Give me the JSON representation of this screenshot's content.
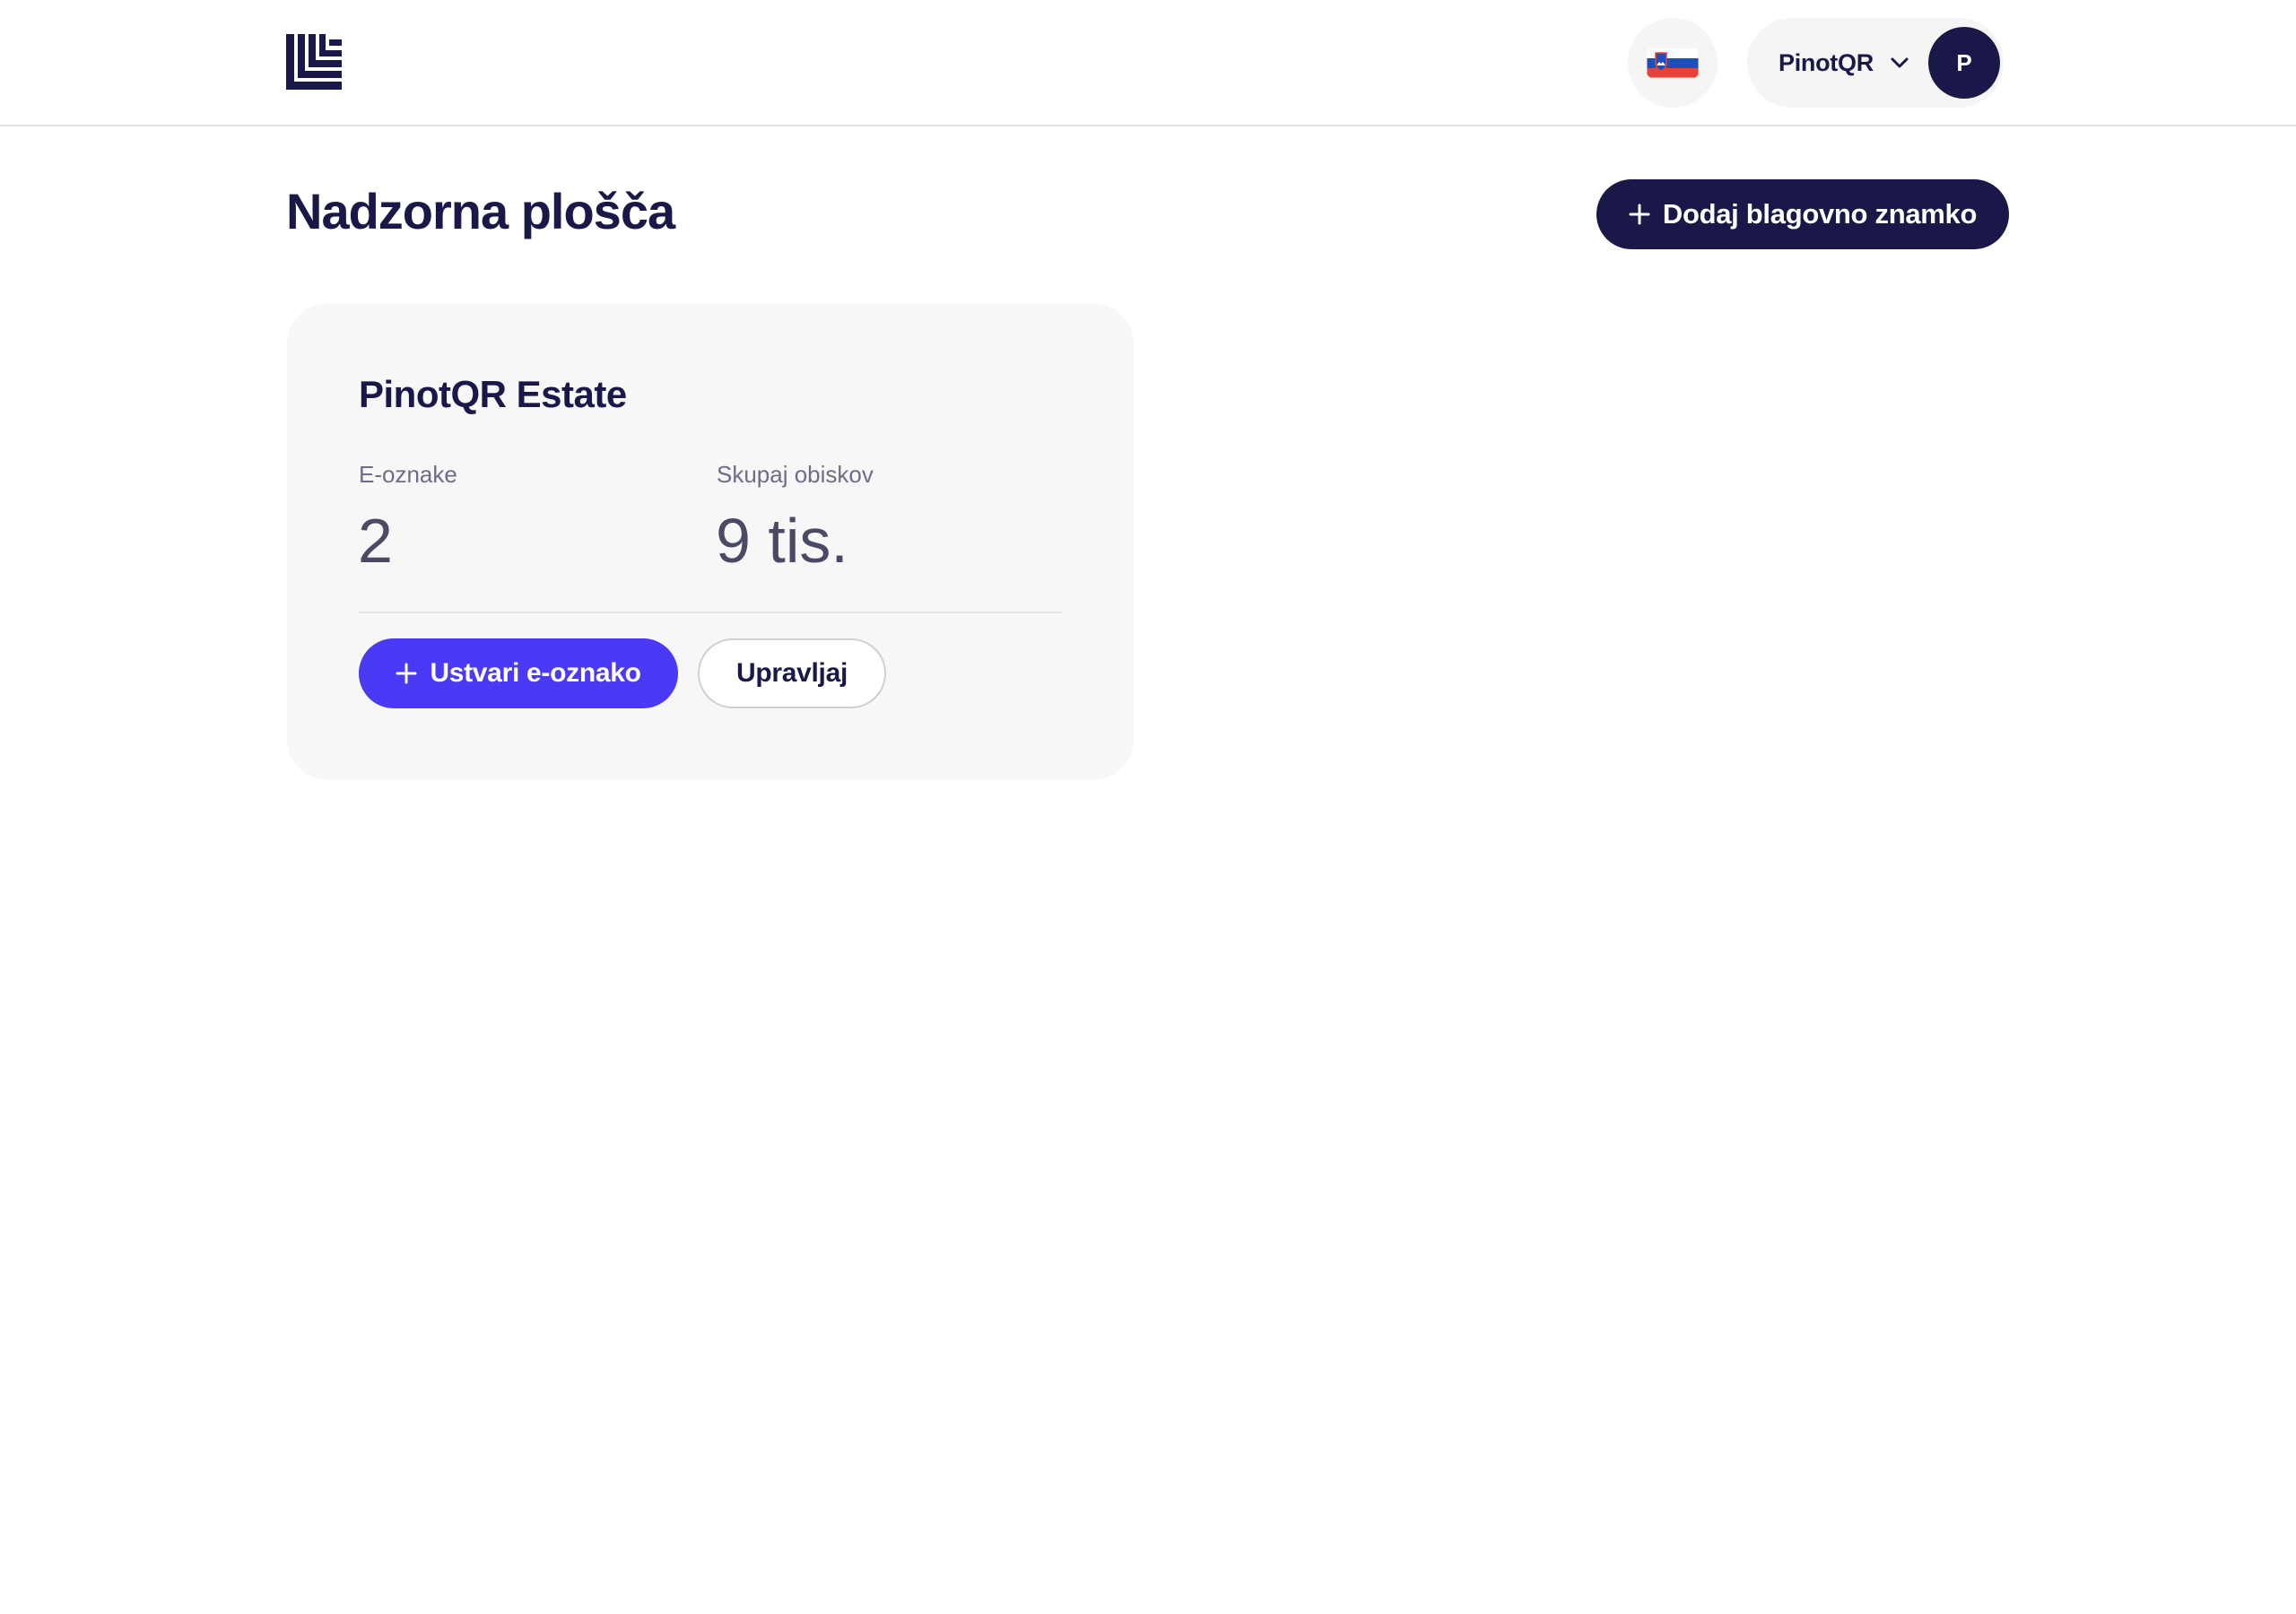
{
  "header": {
    "logo_icon": "brand-logo-icon",
    "language_flag": "slovenia-flag-icon",
    "user": {
      "name": "PinotQR",
      "avatar_initial": "P"
    }
  },
  "main": {
    "title": "Nadzorna plošča",
    "add_brand_label": "Dodaj blagovno znamko"
  },
  "brand_card": {
    "name": "PinotQR Estate",
    "stats": [
      {
        "label": "E-oznake",
        "value": "2"
      },
      {
        "label": "Skupaj obiskov",
        "value": "9 tis."
      }
    ],
    "create_label": "Ustvari e-oznako",
    "manage_label": "Upravljaj"
  },
  "colors": {
    "navy": "#1a1849",
    "accent": "#4a3af5",
    "card_bg": "#f7f7f8"
  }
}
